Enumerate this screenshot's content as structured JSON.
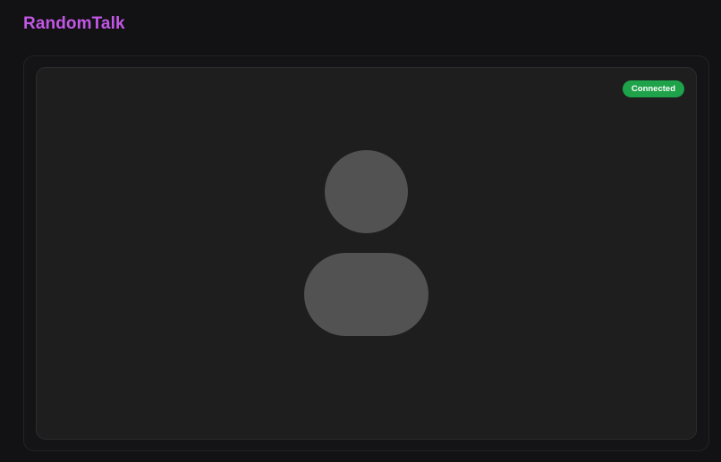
{
  "app": {
    "title": "RandomTalk",
    "brand_color": "#c257e6"
  },
  "video": {
    "status_label": "Connected",
    "status_color": "#1fa34a",
    "placeholder_icon": "user-silhouette-icon",
    "placeholder_color": "#525252"
  }
}
